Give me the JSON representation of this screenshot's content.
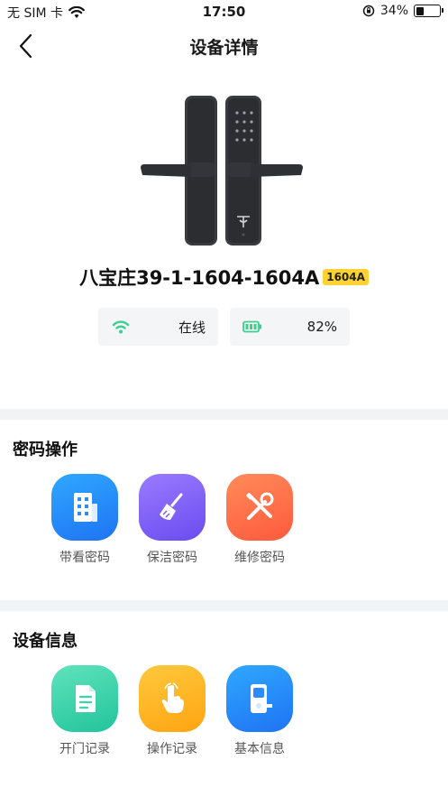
{
  "status_bar": {
    "carrier": "无 SIM 卡",
    "time": "17:50",
    "battery_percent": "34%",
    "battery_level": 0.34
  },
  "nav": {
    "title": "设备详情"
  },
  "device": {
    "name": "八宝庄39-1-1604-1604A",
    "model_badge": "1604A",
    "status_label": "在线",
    "battery_label": "82%",
    "colors": {
      "wifi": "#3ccf8e",
      "battery": "#3ccf8e",
      "badge": "#ffd234"
    }
  },
  "password_section": {
    "title": "密码操作",
    "items": [
      {
        "label": "带看密码",
        "icon": "building-icon",
        "color": "#2a8cff"
      },
      {
        "label": "保洁密码",
        "icon": "broom-icon",
        "color": "#7b5cf5"
      },
      {
        "label": "维修密码",
        "icon": "tools-icon",
        "color": "#ff6a4a"
      }
    ]
  },
  "info_section": {
    "title": "设备信息",
    "items": [
      {
        "label": "开门记录",
        "icon": "document-icon",
        "color": "#3cd4a8"
      },
      {
        "label": "操作记录",
        "icon": "hand-pointer-icon",
        "color": "#ffb320"
      },
      {
        "label": "基本信息",
        "icon": "lock-device-icon",
        "color": "#2a8cff"
      }
    ]
  }
}
